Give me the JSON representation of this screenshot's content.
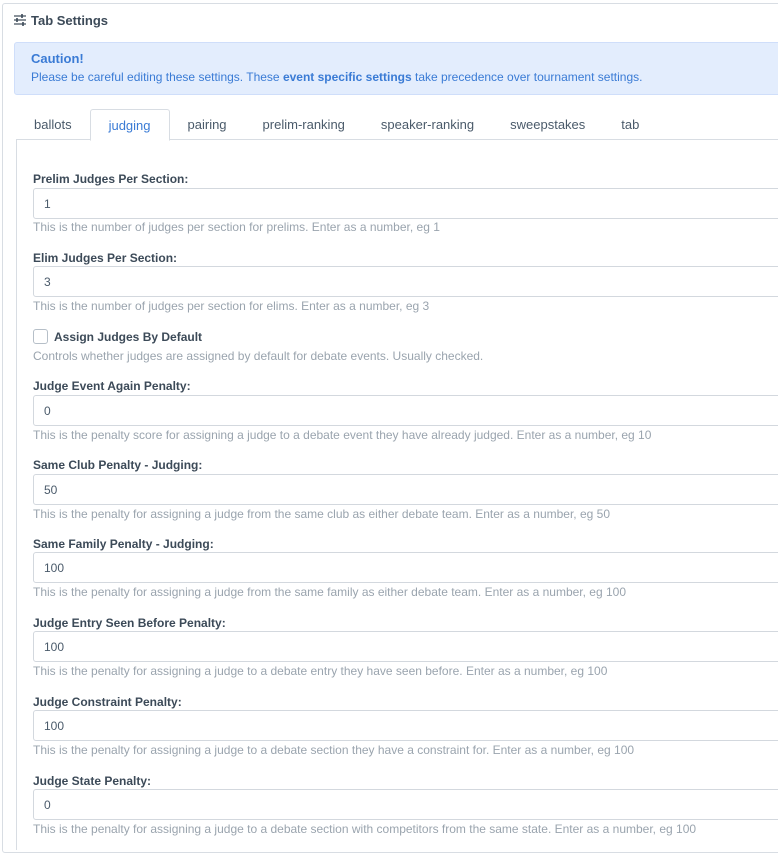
{
  "header": {
    "title": "Tab Settings",
    "icon": "sliders-icon"
  },
  "alert": {
    "title": "Caution!",
    "text_before": "Please be careful editing these settings. These ",
    "text_bold": "event specific settings",
    "text_after": " take precedence over tournament settings."
  },
  "tabs": [
    {
      "label": "ballots",
      "active": false
    },
    {
      "label": "judging",
      "active": true
    },
    {
      "label": "pairing",
      "active": false
    },
    {
      "label": "prelim-ranking",
      "active": false
    },
    {
      "label": "speaker-ranking",
      "active": false
    },
    {
      "label": "sweepstakes",
      "active": false
    },
    {
      "label": "tab",
      "active": false
    }
  ],
  "fields": {
    "prelim_judges": {
      "label": "Prelim Judges Per Section:",
      "value": "1",
      "help": "This is the number of judges per section for prelims. Enter as a number, eg 1"
    },
    "elim_judges": {
      "label": "Elim Judges Per Section:",
      "value": "3",
      "help": "This is the number of judges per section for elims. Enter as a number, eg 3"
    },
    "assign_default": {
      "label": "Assign Judges By Default",
      "checked": false,
      "help": "Controls whether judges are assigned by default for debate events. Usually checked."
    },
    "event_again": {
      "label": "Judge Event Again Penalty:",
      "value": "0",
      "help": "This is the penalty score for assigning a judge to a debate event they have already judged. Enter as a number, eg 10"
    },
    "same_club": {
      "label": "Same Club Penalty - Judging:",
      "value": "50",
      "help": "This is the penalty for assigning a judge from the same club as either debate team. Enter as a number, eg 50"
    },
    "same_family": {
      "label": "Same Family Penalty - Judging:",
      "value": "100",
      "help": "This is the penalty for assigning a judge from the same family as either debate team. Enter as a number, eg 100"
    },
    "entry_seen": {
      "label": "Judge Entry Seen Before Penalty:",
      "value": "100",
      "help": "This is the penalty for assigning a judge to a debate entry they have seen before. Enter as a number, eg 100"
    },
    "constraint": {
      "label": "Judge Constraint Penalty:",
      "value": "100",
      "help": "This is the penalty for assigning a judge to a debate section they have a constraint for. Enter as a number, eg 100"
    },
    "state": {
      "label": "Judge State Penalty:",
      "value": "0",
      "help": "This is the penalty for assigning a judge to a debate section with competitors from the same state. Enter as a number, eg 100"
    }
  },
  "colors": {
    "accent": "#3a7bd5",
    "alert_bg": "#e3edfd",
    "help_text": "#9aa4ae"
  }
}
